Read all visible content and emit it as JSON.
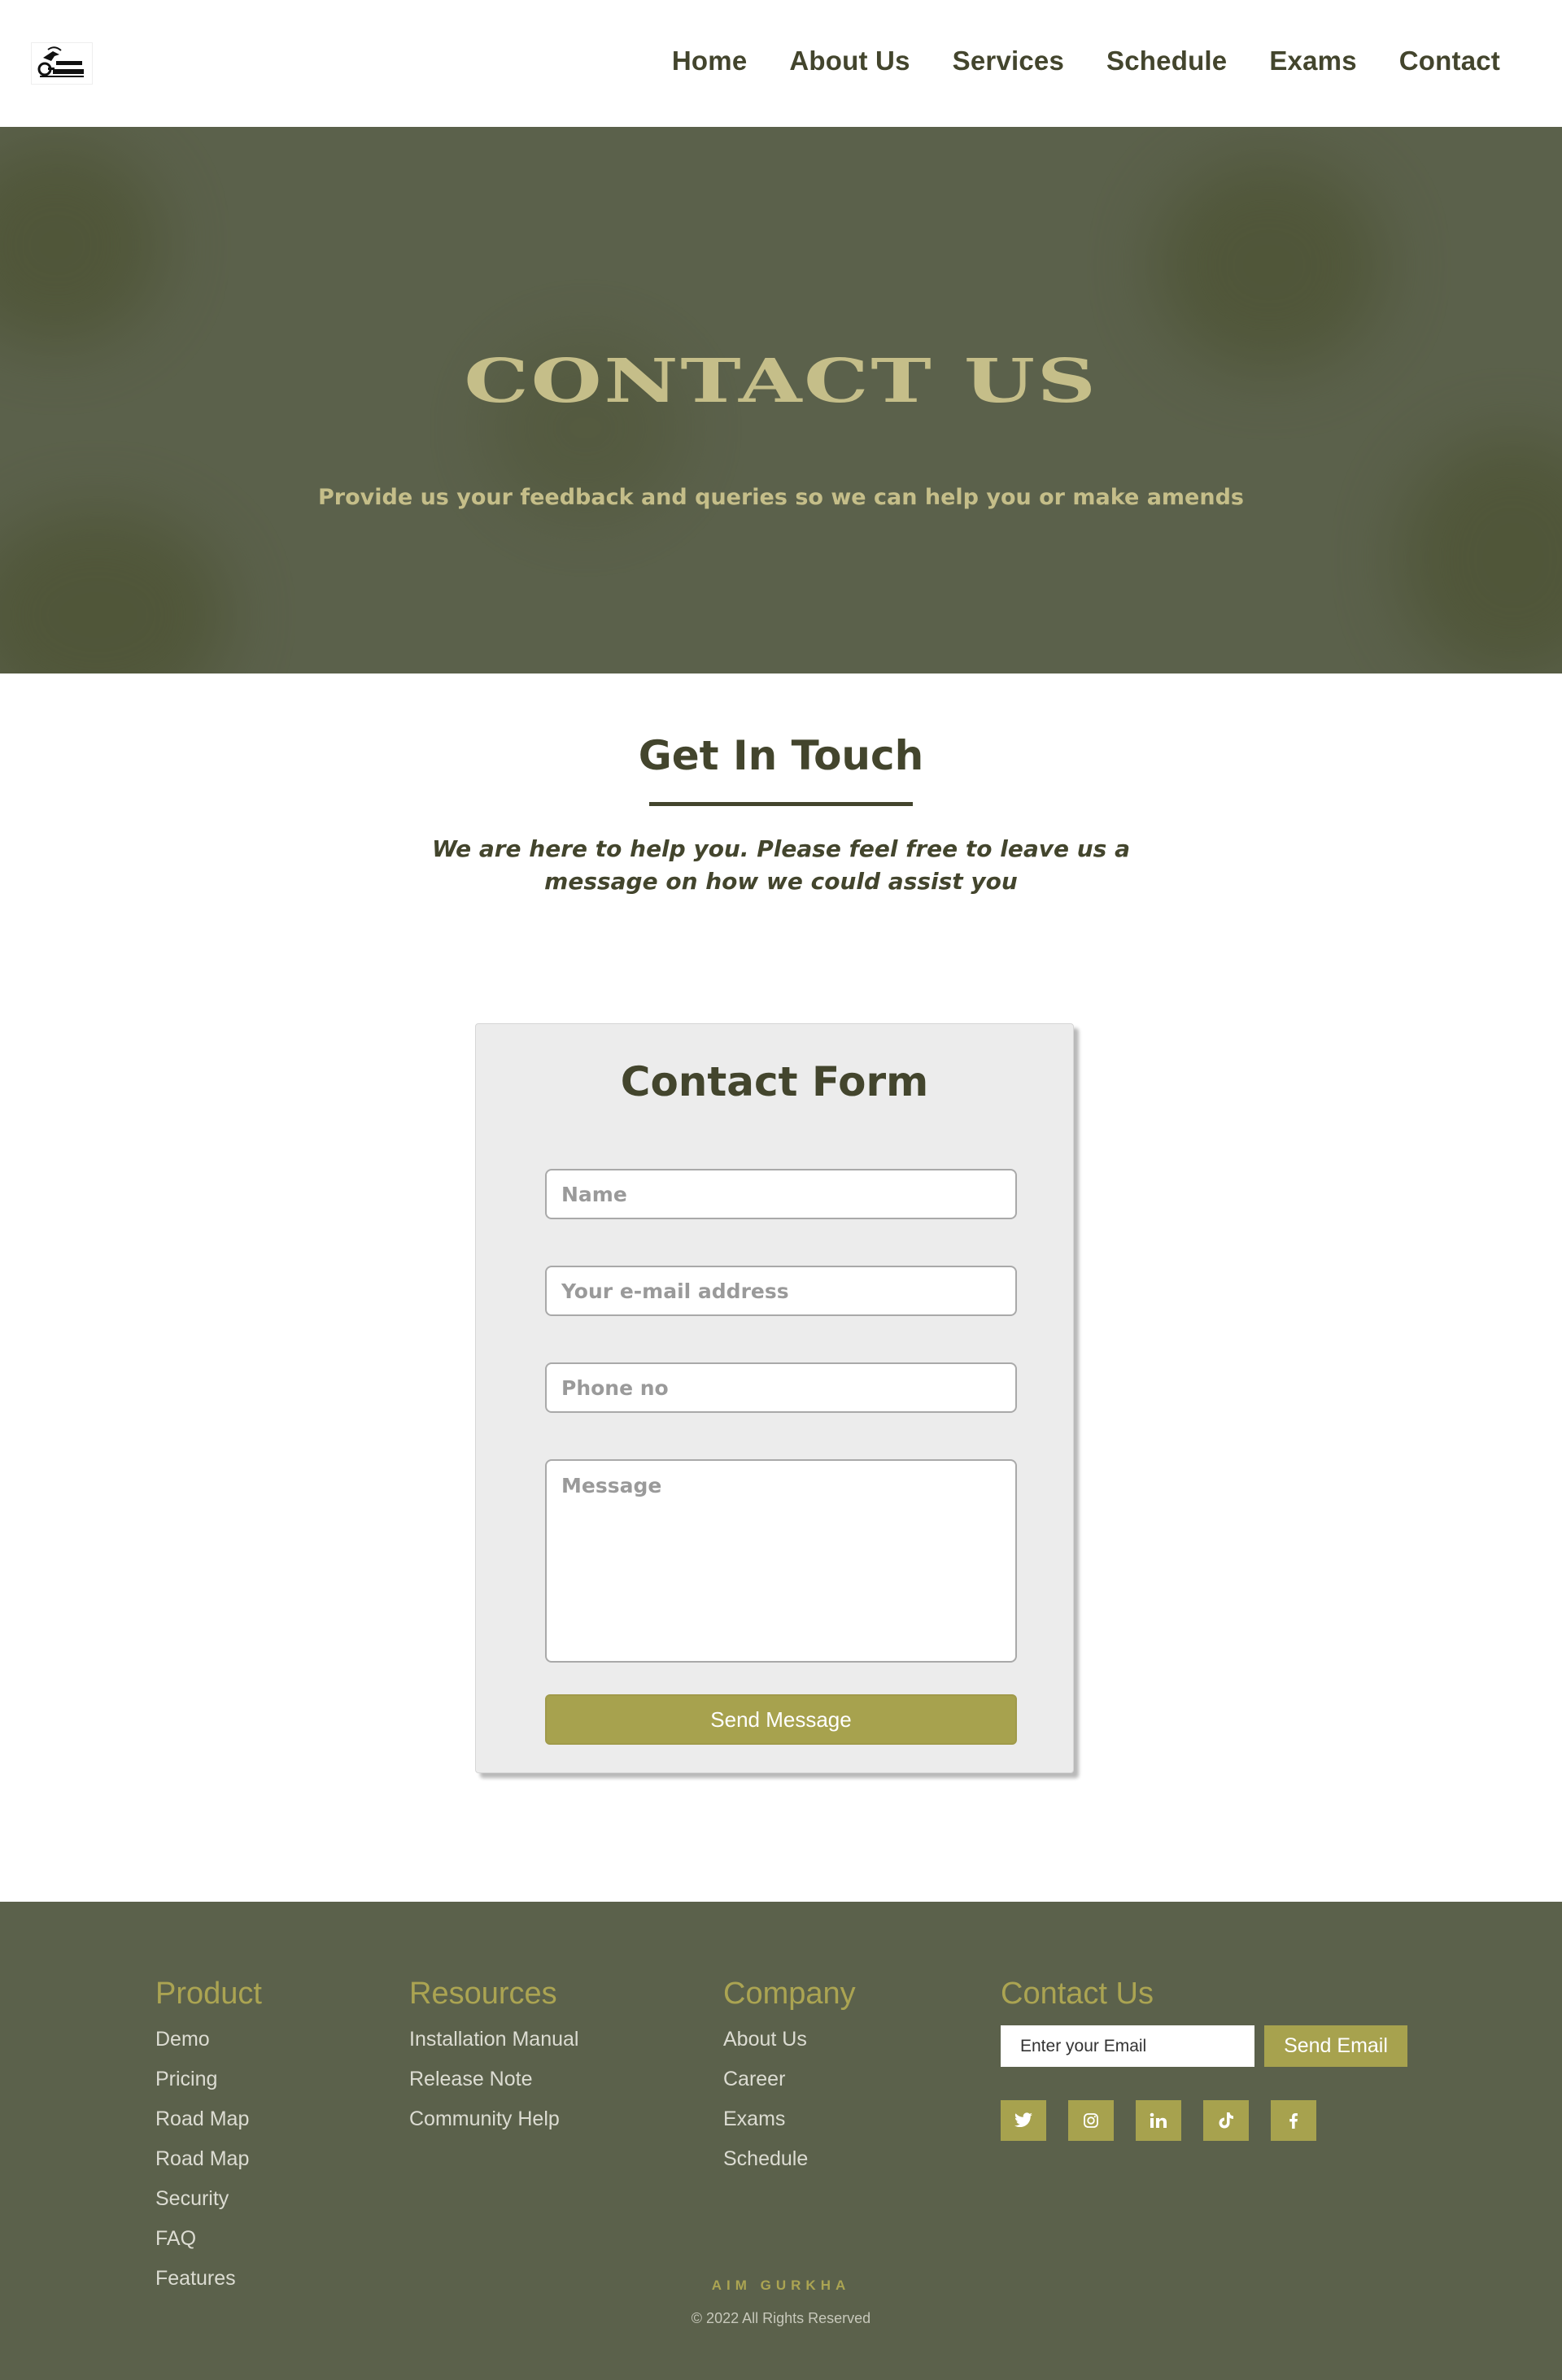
{
  "header": {
    "logo_alt": "AIM GURKHA",
    "nav": [
      "Home",
      "About Us",
      "Services",
      "Schedule",
      "Exams",
      "Contact"
    ]
  },
  "hero": {
    "title": "CONTACT US",
    "subtitle": "Provide us your feedback and queries so we can help you or make amends"
  },
  "get_in_touch": {
    "title": "Get In Touch",
    "text": "We are here to help you. Please feel free to leave us a message on how we could assist you"
  },
  "form": {
    "title": "Contact Form",
    "name_placeholder": "Name",
    "email_placeholder": "Your e-mail address",
    "phone_placeholder": "Phone no",
    "message_placeholder": "Message",
    "submit_label": "Send Message"
  },
  "footer": {
    "product": {
      "title": "Product",
      "links": [
        "Demo",
        "Pricing",
        "Road Map",
        "Road Map",
        "Security",
        "FAQ",
        "Features"
      ]
    },
    "resources": {
      "title": "Resources",
      "links": [
        "Installation Manual",
        "Release Note",
        "Community Help"
      ]
    },
    "company": {
      "title": "Company",
      "links": [
        "About Us",
        "Career",
        "Exams",
        "Schedule"
      ]
    },
    "contact": {
      "title": "Contact Us",
      "email_placeholder": "Enter your Email",
      "send_label": "Send Email",
      "socials": [
        "twitter-icon",
        "instagram-icon",
        "linkedin-icon",
        "tiktok-icon",
        "facebook-icon"
      ]
    },
    "brand": "AIM GURKHA",
    "copyright": "© 2022 All Rights Reserved"
  },
  "colors": {
    "olive_dark": "#43452d",
    "hero_bg": "#5b614b",
    "accent": "#a7a24e",
    "hero_text": "#c5be89"
  }
}
